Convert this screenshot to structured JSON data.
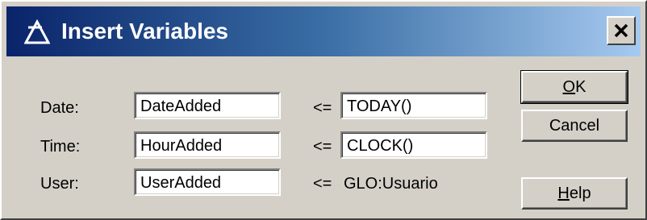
{
  "window": {
    "title": "Insert Variables",
    "title_icon": "delta-app-icon",
    "close_icon": "close-icon"
  },
  "rows": [
    {
      "label": "Date:",
      "variable": "DateAdded",
      "operator": "<=",
      "source": "TODAY()",
      "source_is_field": true
    },
    {
      "label": "Time:",
      "variable": "HourAdded",
      "operator": "<=",
      "source": "CLOCK()",
      "source_is_field": true
    },
    {
      "label": "User:",
      "variable": "UserAdded",
      "operator": "<=",
      "source": "GLO:Usuario",
      "source_is_field": false
    }
  ],
  "buttons": {
    "ok": {
      "mnemonic": "O",
      "rest": "K"
    },
    "cancel": {
      "label": "Cancel"
    },
    "help": {
      "mnemonic": "H",
      "rest": "elp"
    }
  },
  "colors": {
    "dialog_face": "#d4d0c8",
    "titlebar_start": "#0a246a",
    "titlebar_end": "#a6caf0"
  }
}
